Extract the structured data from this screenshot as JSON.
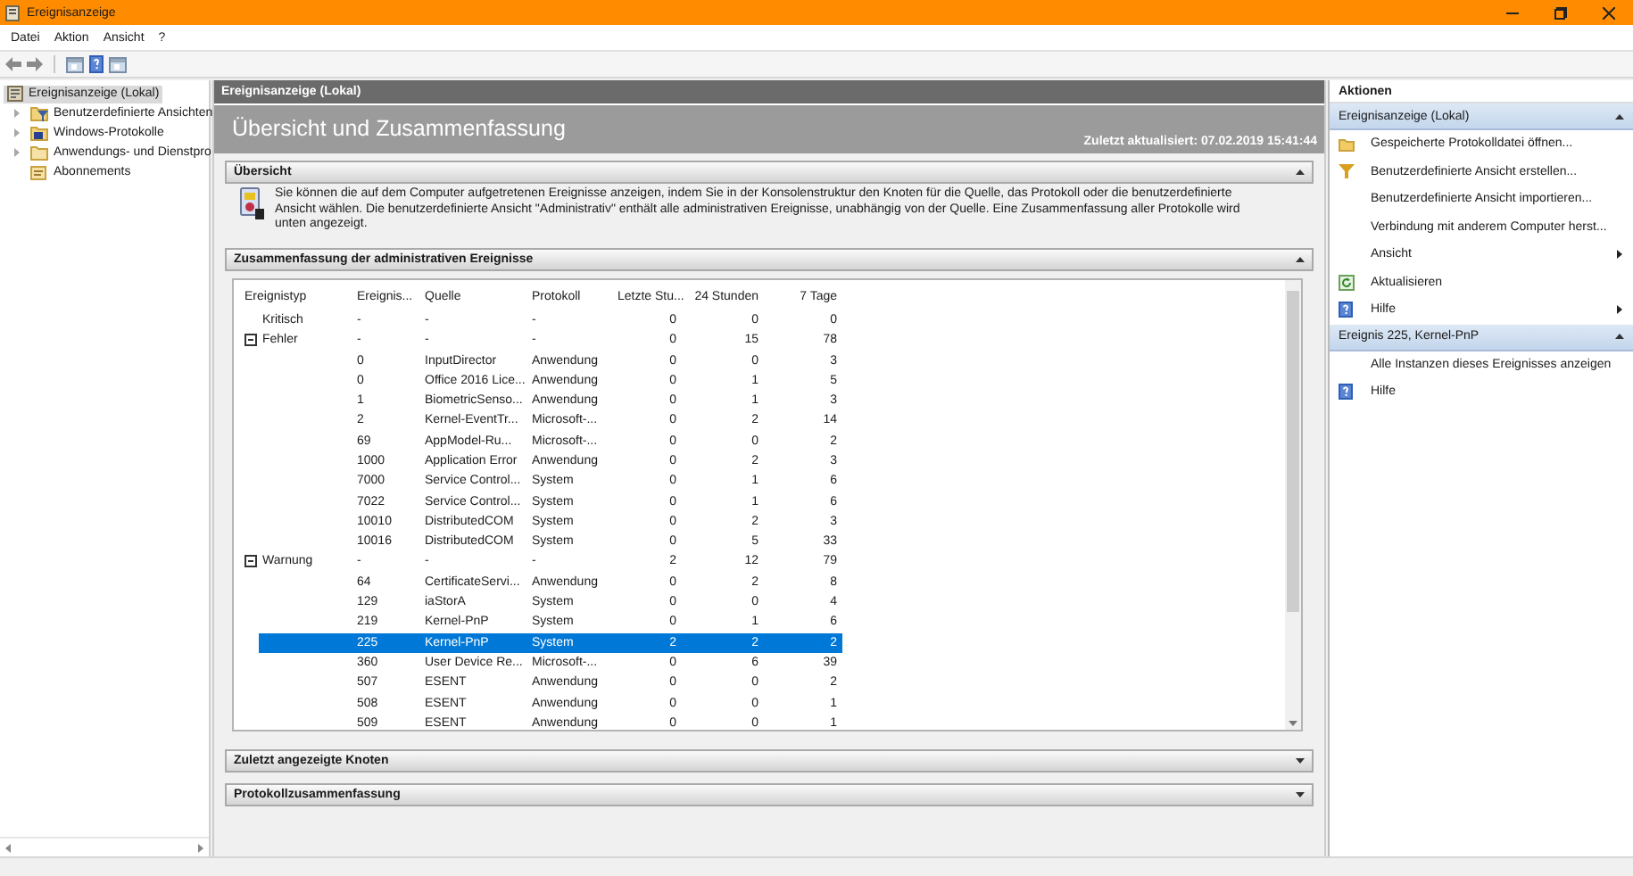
{
  "window": {
    "title": "Ereignisanzeige"
  },
  "menu": [
    "Datei",
    "Aktion",
    "Ansicht",
    "?"
  ],
  "tree": {
    "items": [
      {
        "label": "Ereignisanzeige (Lokal)",
        "kind": "viewer",
        "selected": true,
        "expandable": false,
        "children": [
          {
            "label": "Benutzerdefinierte Ansichten",
            "kind": "filter-folder",
            "selected": false,
            "expandable": true
          },
          {
            "label": "Windows-Protokolle",
            "kind": "log",
            "selected": false,
            "expandable": true
          },
          {
            "label": "Anwendungs- und Dienstpro",
            "kind": "folder",
            "selected": false,
            "expandable": true
          },
          {
            "label": "Abonnements",
            "kind": "subscription",
            "selected": false,
            "expandable": false
          }
        ]
      }
    ]
  },
  "panel": {
    "breadcrumb": "Ereignisanzeige (Lokal)",
    "title": "Übersicht und Zusammenfassung",
    "updated": "Zuletzt aktualisiert: 07.02.2019 15:41:44",
    "sections": [
      {
        "title": "Übersicht",
        "expanded": true,
        "text": "Sie können die auf dem Computer aufgetretenen Ereignisse anzeigen, indem Sie in der Konsolenstruktur den Knoten für die Quelle, das Protokoll oder die benutzerdefinierte Ansicht wählen. Die benutzerdefinierte Ansicht \"Administrativ\" enthält alle administrativen Ereignisse, unabhängig von der Quelle. Eine Zusammenfassung aller Protokolle wird unten angezeigt."
      },
      {
        "title": "Zusammenfassung der administrativen Ereignisse",
        "expanded": true,
        "table": {
          "columns": [
            "Ereignistyp",
            "Ereignis...",
            "Quelle",
            "Protokoll",
            "Letzte Stu...",
            "24 Stunden",
            "7 Tage"
          ],
          "groups": [
            {
              "type": "Kritisch",
              "expandable": false,
              "selected": false,
              "cells": [
                "-",
                "-",
                "-",
                "0",
                "0",
                "0"
              ]
            },
            {
              "type": "Fehler",
              "expandable": true,
              "expanded": true,
              "selected": false,
              "cells": [
                "-",
                "-",
                "-",
                "0",
                "15",
                "78"
              ],
              "children": [
                {
                  "cells": [
                    "0",
                    "InputDirector",
                    "Anwendung",
                    "0",
                    "0",
                    "3"
                  ],
                  "selected": false
                },
                {
                  "cells": [
                    "0",
                    "Office 2016 Lice...",
                    "Anwendung",
                    "0",
                    "1",
                    "5"
                  ],
                  "selected": false
                },
                {
                  "cells": [
                    "1",
                    "BiometricSenso...",
                    "Anwendung",
                    "0",
                    "1",
                    "3"
                  ],
                  "selected": false
                },
                {
                  "cells": [
                    "2",
                    "Kernel-EventTr...",
                    "Microsoft-...",
                    "0",
                    "2",
                    "14"
                  ],
                  "selected": false
                },
                {
                  "cells": [
                    "69",
                    "AppModel-Ru...",
                    "Microsoft-...",
                    "0",
                    "0",
                    "2"
                  ],
                  "selected": false
                },
                {
                  "cells": [
                    "1000",
                    "Application Error",
                    "Anwendung",
                    "0",
                    "2",
                    "3"
                  ],
                  "selected": false
                },
                {
                  "cells": [
                    "7000",
                    "Service Control...",
                    "System",
                    "0",
                    "1",
                    "6"
                  ],
                  "selected": false
                },
                {
                  "cells": [
                    "7022",
                    "Service Control...",
                    "System",
                    "0",
                    "1",
                    "6"
                  ],
                  "selected": false
                },
                {
                  "cells": [
                    "10010",
                    "DistributedCOM",
                    "System",
                    "0",
                    "2",
                    "3"
                  ],
                  "selected": false
                },
                {
                  "cells": [
                    "10016",
                    "DistributedCOM",
                    "System",
                    "0",
                    "5",
                    "33"
                  ],
                  "selected": false
                }
              ]
            },
            {
              "type": "Warnung",
              "expandable": true,
              "expanded": true,
              "selected": false,
              "cells": [
                "-",
                "-",
                "-",
                "2",
                "12",
                "79"
              ],
              "children": [
                {
                  "cells": [
                    "64",
                    "CertificateServi...",
                    "Anwendung",
                    "0",
                    "2",
                    "8"
                  ],
                  "selected": false
                },
                {
                  "cells": [
                    "129",
                    "iaStorA",
                    "System",
                    "0",
                    "0",
                    "4"
                  ],
                  "selected": false
                },
                {
                  "cells": [
                    "219",
                    "Kernel-PnP",
                    "System",
                    "0",
                    "1",
                    "6"
                  ],
                  "selected": false
                },
                {
                  "cells": [
                    "225",
                    "Kernel-PnP",
                    "System",
                    "2",
                    "2",
                    "2"
                  ],
                  "selected": true
                },
                {
                  "cells": [
                    "360",
                    "User Device Re...",
                    "Microsoft-...",
                    "0",
                    "6",
                    "39"
                  ],
                  "selected": false
                },
                {
                  "cells": [
                    "507",
                    "ESENT",
                    "Anwendung",
                    "0",
                    "0",
                    "2"
                  ],
                  "selected": false
                },
                {
                  "cells": [
                    "508",
                    "ESENT",
                    "Anwendung",
                    "0",
                    "0",
                    "1"
                  ],
                  "selected": false
                },
                {
                  "cells": [
                    "509",
                    "ESENT",
                    "Anwendung",
                    "0",
                    "0",
                    "1"
                  ],
                  "selected": false
                }
              ]
            }
          ]
        }
      },
      {
        "title": "Zuletzt angezeigte Knoten",
        "expanded": false
      },
      {
        "title": "Protokollzusammenfassung",
        "expanded": false
      }
    ]
  },
  "actions": {
    "title": "Aktionen",
    "groups": [
      {
        "title": "Ereignisanzeige (Lokal)",
        "expanded": true,
        "items": [
          {
            "label": "Gespeicherte Protokolldatei öffnen...",
            "kind": "folder",
            "submenu": false
          },
          {
            "label": "Benutzerdefinierte Ansicht erstellen...",
            "kind": "filter",
            "submenu": false
          },
          {
            "label": "Benutzerdefinierte Ansicht importieren...",
            "kind": "plain",
            "submenu": false
          },
          {
            "label": "Verbindung mit anderem Computer herst...",
            "kind": "plain",
            "submenu": false
          },
          {
            "label": "Ansicht",
            "kind": "plain",
            "submenu": true
          },
          {
            "label": "Aktualisieren",
            "kind": "refresh",
            "submenu": false
          },
          {
            "label": "Hilfe",
            "kind": "help",
            "submenu": true
          }
        ]
      },
      {
        "title": "Ereignis 225, Kernel-PnP",
        "expanded": true,
        "items": [
          {
            "label": "Alle Instanzen dieses Ereignisses anzeigen",
            "kind": "plain",
            "submenu": false
          },
          {
            "label": "Hilfe",
            "kind": "help",
            "submenu": false
          }
        ]
      }
    ]
  }
}
